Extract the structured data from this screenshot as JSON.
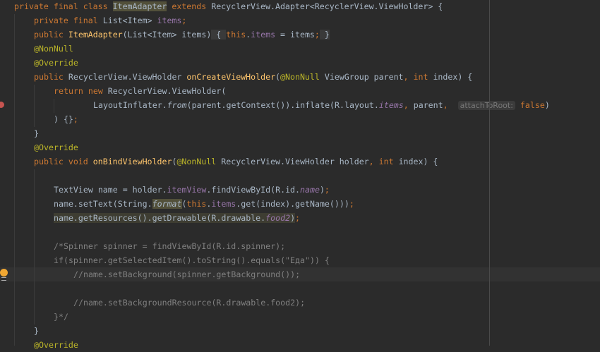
{
  "editor": {
    "colors": {
      "background": "#2b2b2b",
      "keyword": "#cc7832",
      "annotation": "#bbb529",
      "field": "#9876aa",
      "method": "#ffc66d",
      "comment": "#808080",
      "text": "#a9b7c6"
    },
    "breakpoint_line": 7,
    "current_line": 19,
    "lines": [
      {
        "indent": 0,
        "tokens": [
          [
            "private final class ",
            "kw"
          ],
          [
            "ItemAdapter",
            "hl"
          ],
          [
            " extends ",
            "kw"
          ],
          [
            "RecyclerView.Adapter<RecyclerView.ViewHolder> {",
            ""
          ]
        ]
      },
      {
        "indent": 4,
        "tokens": [
          [
            "private final ",
            "kw"
          ],
          [
            "List<Item> ",
            ""
          ],
          [
            "items",
            "fld"
          ],
          [
            ";",
            "kw"
          ]
        ]
      },
      {
        "indent": 4,
        "tokens": [
          [
            "public ",
            "kw"
          ],
          [
            "ItemAdapter",
            "mth"
          ],
          [
            "(List<Item> items)",
            ""
          ],
          [
            " { ",
            "fold"
          ],
          [
            "this",
            "kw"
          ],
          [
            ".",
            ""
          ],
          [
            "items",
            "fld"
          ],
          [
            " = items",
            ""
          ],
          [
            ";",
            "kw"
          ],
          [
            " }",
            "fold"
          ]
        ]
      },
      {
        "indent": 4,
        "tokens": [
          [
            "@NonNull",
            "ann"
          ]
        ]
      },
      {
        "indent": 4,
        "tokens": [
          [
            "@Override",
            "ann"
          ]
        ]
      },
      {
        "indent": 4,
        "tokens": [
          [
            "public ",
            "kw"
          ],
          [
            "RecyclerView.ViewHolder ",
            ""
          ],
          [
            "onCreateViewHolder",
            "mth"
          ],
          [
            "(",
            ""
          ],
          [
            "@NonNull",
            "ann"
          ],
          [
            " ViewGroup parent",
            ""
          ],
          [
            ", ",
            "kw"
          ],
          [
            "int ",
            "kw"
          ],
          [
            "index) {",
            ""
          ]
        ]
      },
      {
        "indent": 8,
        "tokens": [
          [
            "return new ",
            "kw"
          ],
          [
            "RecyclerView.ViewHolder(",
            ""
          ]
        ]
      },
      {
        "indent": 16,
        "tokens": [
          [
            "LayoutInflater.",
            ""
          ],
          [
            "from",
            "ital"
          ],
          [
            "(parent.getContext()).inflate(R.layout.",
            ""
          ],
          [
            "items",
            "fldi"
          ],
          [
            ", ",
            "kw"
          ],
          [
            "parent",
            ""
          ],
          [
            ", ",
            "kw"
          ],
          [
            "attachToRoot:",
            "hint"
          ],
          [
            " ",
            ""
          ],
          [
            "false",
            "kw"
          ],
          [
            ")",
            ""
          ]
        ]
      },
      {
        "indent": 8,
        "tokens": [
          [
            ") {}",
            ""
          ],
          [
            ";",
            "kw"
          ]
        ]
      },
      {
        "indent": 4,
        "tokens": [
          [
            "}",
            ""
          ]
        ]
      },
      {
        "indent": 4,
        "tokens": [
          [
            "@Override",
            "ann"
          ]
        ]
      },
      {
        "indent": 4,
        "tokens": [
          [
            "public void ",
            "kw"
          ],
          [
            "onBindViewHolder",
            "mth"
          ],
          [
            "(",
            ""
          ],
          [
            "@NonNull",
            "ann"
          ],
          [
            " RecyclerView.ViewHolder holder",
            ""
          ],
          [
            ", ",
            "kw"
          ],
          [
            "int ",
            "kw"
          ],
          [
            "index) {",
            ""
          ]
        ]
      },
      {
        "indent": 0,
        "tokens": []
      },
      {
        "indent": 8,
        "tokens": [
          [
            "TextView name = holder.",
            ""
          ],
          [
            "itemView",
            "fld"
          ],
          [
            ".findViewById(R.id.",
            ""
          ],
          [
            "name",
            "fldi"
          ],
          [
            ")",
            ""
          ],
          [
            ";",
            "kw"
          ]
        ]
      },
      {
        "indent": 8,
        "tokens": [
          [
            "name.setText(String.",
            ""
          ],
          [
            "format",
            "ital hl"
          ],
          [
            "(",
            ""
          ],
          [
            "this",
            "kw"
          ],
          [
            ".",
            ""
          ],
          [
            "items",
            "fld"
          ],
          [
            ".get(index).getName()))",
            ""
          ],
          [
            ";",
            "kw"
          ]
        ]
      },
      {
        "indent": 8,
        "tokens": [
          [
            "name.getResources().getDrawable(R.drawable.",
            "hlline"
          ],
          [
            "food2",
            "fldi hlline"
          ],
          [
            ")",
            "hlline"
          ],
          [
            ";",
            "kw"
          ]
        ]
      },
      {
        "indent": 0,
        "tokens": []
      },
      {
        "indent": 8,
        "tokens": [
          [
            "/*Spinner spinner = findViewById(R.id.spinner);",
            "cmt"
          ]
        ]
      },
      {
        "indent": 8,
        "tokens": [
          [
            "if(spinner.getSelectedItem().toString().equals(\"Еда\")) {",
            "cmt"
          ]
        ]
      },
      {
        "indent": 12,
        "tokens": [
          [
            "//name.setBackground(spinner.getBackground());",
            "cmt"
          ]
        ]
      },
      {
        "indent": 0,
        "tokens": []
      },
      {
        "indent": 12,
        "tokens": [
          [
            "//name.setBackgroundResource(R.drawable.food2);",
            "cmt"
          ]
        ]
      },
      {
        "indent": 8,
        "tokens": [
          [
            "}*/",
            "cmt"
          ]
        ]
      },
      {
        "indent": 4,
        "tokens": [
          [
            "}",
            ""
          ]
        ]
      },
      {
        "indent": 4,
        "tokens": [
          [
            "@Override",
            "ann"
          ]
        ]
      }
    ]
  }
}
